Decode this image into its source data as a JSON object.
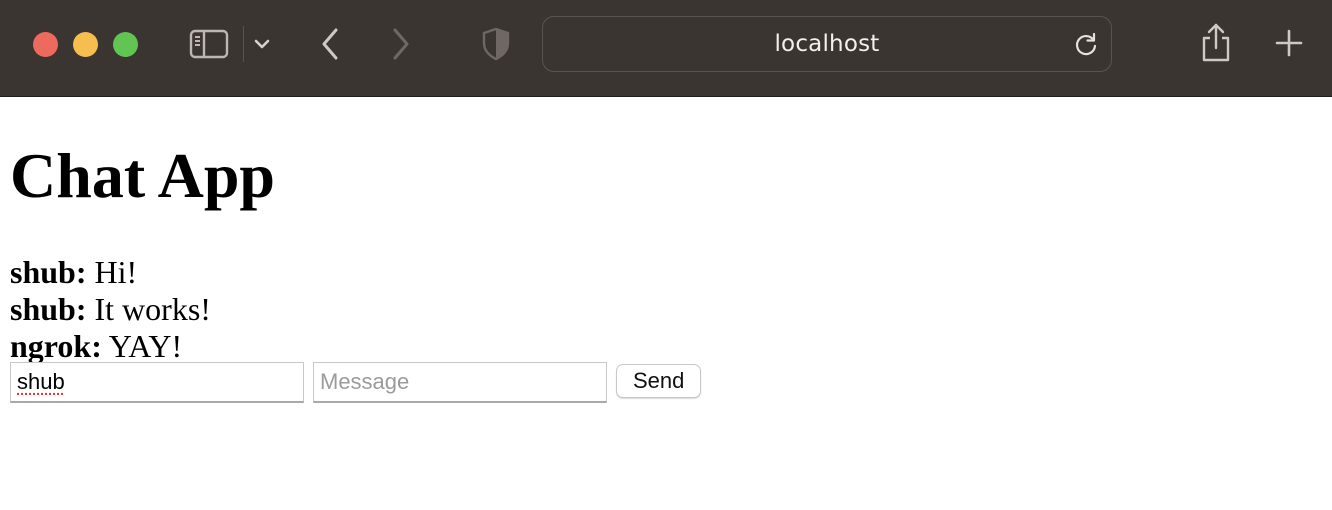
{
  "browser": {
    "address": "localhost",
    "colors": {
      "toolbar": "#3b3532",
      "close": "#ee6a5f",
      "minimize": "#f5be4f",
      "zoom": "#61c554"
    },
    "icons": [
      "sidebar-icon",
      "chevron-down-icon",
      "back-arrow-icon",
      "forward-arrow-icon",
      "shield-icon",
      "reload-icon",
      "share-icon",
      "plus-icon"
    ]
  },
  "page": {
    "title": "Chat App",
    "messages": [
      {
        "sender": "shub:",
        "text": " Hi!"
      },
      {
        "sender": "shub:",
        "text": " It works!"
      },
      {
        "sender": "ngrok:",
        "text": " YAY!"
      }
    ],
    "form": {
      "name_value": "shub",
      "message_placeholder": "Message",
      "send_label": "Send"
    }
  }
}
